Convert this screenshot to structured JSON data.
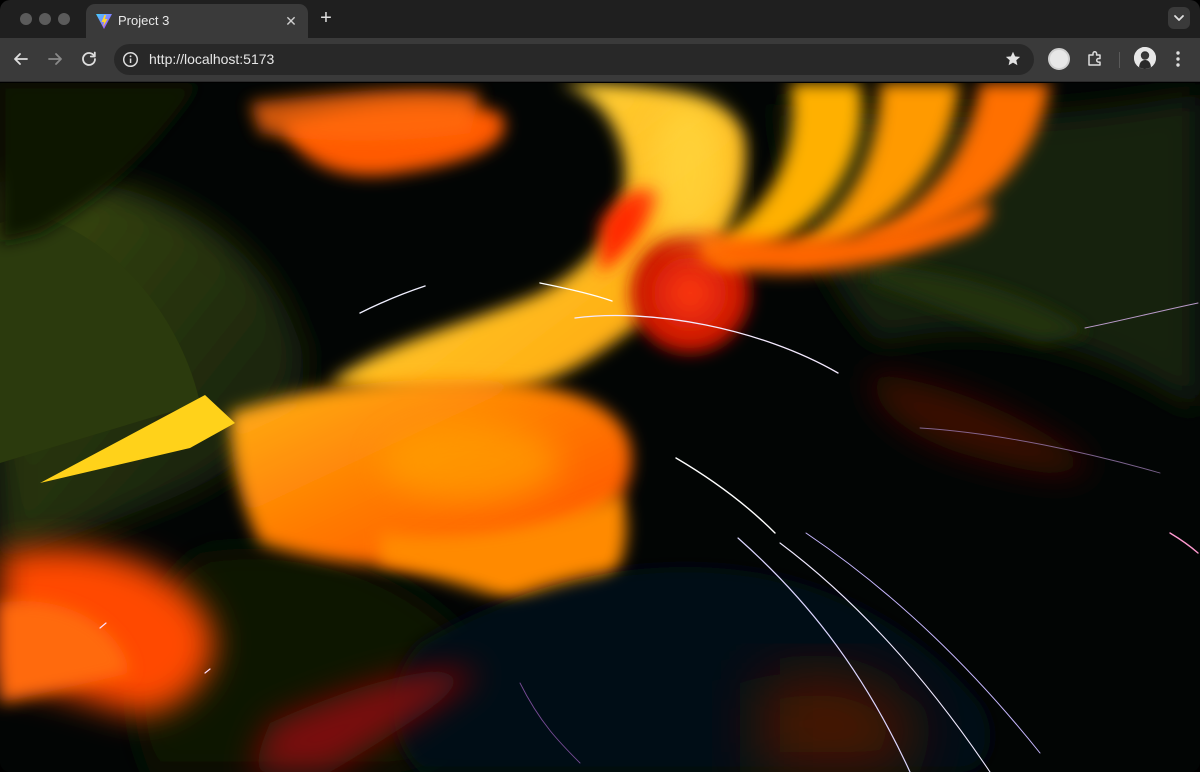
{
  "window": {
    "tabs": [
      {
        "title": "Project 3",
        "favicon": "vite-logo-icon",
        "active": true
      }
    ]
  },
  "toolbar": {
    "url": "http://localhost:5173",
    "icons": [
      "back-arrow-icon",
      "forward-arrow-icon",
      "reload-icon",
      "site-info-icon",
      "bookmark-star-icon",
      "extensions-puzzle-icon",
      "kebab-menu-icon"
    ]
  },
  "page": {
    "content": "three.js particle scene",
    "colors": {
      "orange": "#ff6a00",
      "yellow": "#ffd21a",
      "red": "#e21a05",
      "dark_green": "#1c2a08",
      "background": "#020504"
    }
  }
}
